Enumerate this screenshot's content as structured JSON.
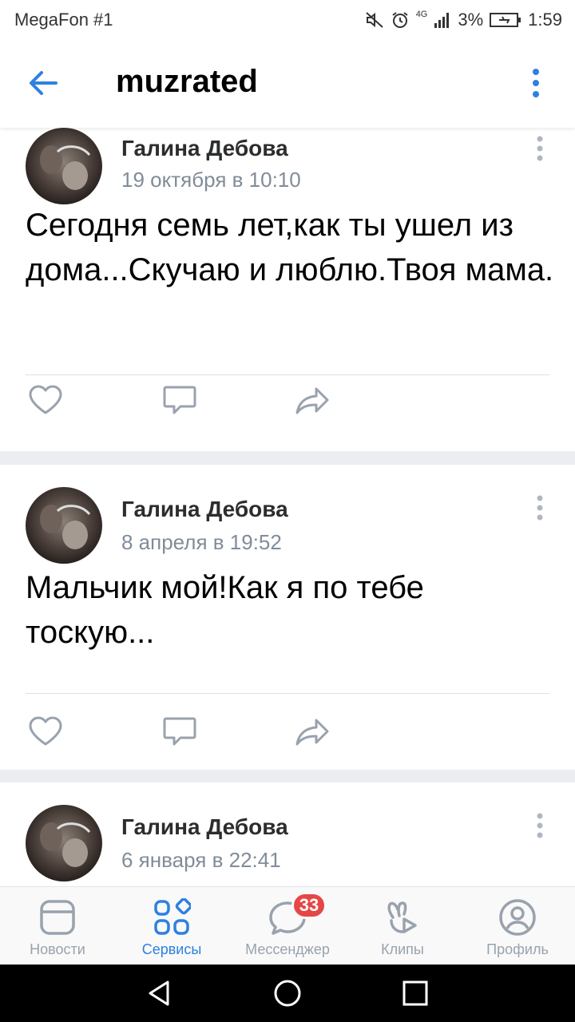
{
  "status_bar": {
    "carrier": "MegaFon #1",
    "network": "4G",
    "battery": "3%",
    "time": "1:59"
  },
  "header": {
    "title": "muzrated",
    "back_icon": "arrow-left-icon",
    "menu_icon": "more-vertical-icon"
  },
  "posts": [
    {
      "author": "Галина Дебова",
      "date": "19 октября в 10:10",
      "text": "Сегодня семь лет,как ты ушел из дома...Скучаю и люблю.Твоя мама."
    },
    {
      "author": "Галина Дебова",
      "date": "8 апреля в 19:52",
      "text": "Мальчик мой!Как я по тебе тоскую..."
    },
    {
      "author": "Галина Дебова",
      "date": "6 января в 22:41",
      "text": ""
    }
  ],
  "tabbar": {
    "items": [
      {
        "label": "Новости",
        "icon": "news-icon",
        "active": false
      },
      {
        "label": "Сервисы",
        "icon": "services-icon",
        "active": true
      },
      {
        "label": "Мессенджер",
        "icon": "messenger-icon",
        "active": false,
        "badge": "33"
      },
      {
        "label": "Клипы",
        "icon": "clips-icon",
        "active": false
      },
      {
        "label": "Профиль",
        "icon": "profile-icon",
        "active": false
      }
    ]
  },
  "colors": {
    "accent": "#2d81e0",
    "badge": "#e64646",
    "secondary_text": "#818c99",
    "icon_gray": "#99a2ad"
  }
}
